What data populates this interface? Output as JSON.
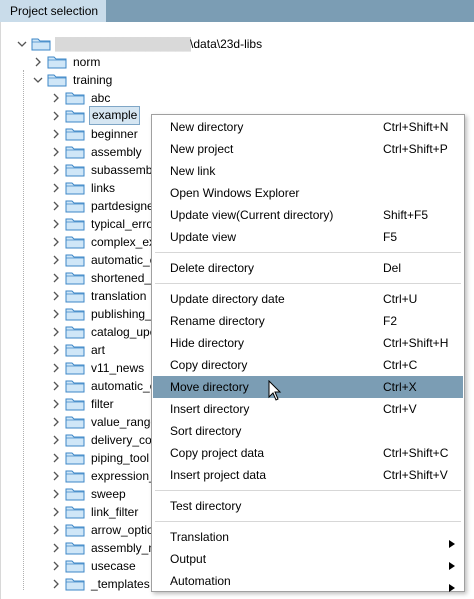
{
  "header": {
    "tab_label": "Project selection"
  },
  "tree": {
    "root": {
      "path_mask": "██████████████████",
      "path_suffix": "\\data\\23d-libs",
      "expanded": true
    },
    "level1": [
      {
        "label": "norm",
        "expanded": false
      },
      {
        "label": "training",
        "expanded": true
      }
    ],
    "children": [
      {
        "label": "abc"
      },
      {
        "label": "example",
        "selected": true
      },
      {
        "label": "beginner"
      },
      {
        "label": "assembly"
      },
      {
        "label": "subassembl"
      },
      {
        "label": "links"
      },
      {
        "label": "partdesigne"
      },
      {
        "label": "typical_erro"
      },
      {
        "label": "complex_ex"
      },
      {
        "label": "automatic_c"
      },
      {
        "label": "shortened_v"
      },
      {
        "label": "translation"
      },
      {
        "label": "publishing_"
      },
      {
        "label": "catalog_upc"
      },
      {
        "label": "art"
      },
      {
        "label": "v11_news"
      },
      {
        "label": "automatic_c"
      },
      {
        "label": "filter"
      },
      {
        "label": "value_range"
      },
      {
        "label": "delivery_co"
      },
      {
        "label": "piping_tool"
      },
      {
        "label": "expression_"
      },
      {
        "label": "sweep"
      },
      {
        "label": "link_filter"
      },
      {
        "label": "arrow_optio"
      },
      {
        "label": "assembly_m"
      },
      {
        "label": "usecase"
      },
      {
        "label": "_templates"
      }
    ]
  },
  "context_menu": {
    "items": [
      {
        "label": "New directory",
        "shortcut": "Ctrl+Shift+N"
      },
      {
        "label": "New project",
        "shortcut": "Ctrl+Shift+P"
      },
      {
        "label": "New link",
        "shortcut": ""
      },
      {
        "label": "Open Windows Explorer",
        "shortcut": ""
      },
      {
        "label": "Update view(Current directory)",
        "shortcut": "Shift+F5"
      },
      {
        "label": "Update view",
        "shortcut": "F5"
      },
      {
        "label": "Delete directory",
        "shortcut": "Del"
      },
      {
        "label": "Update directory date",
        "shortcut": "Ctrl+U"
      },
      {
        "label": "Rename directory",
        "shortcut": "F2"
      },
      {
        "label": "Hide directory",
        "shortcut": "Ctrl+Shift+H"
      },
      {
        "label": "Copy directory",
        "shortcut": "Ctrl+C"
      },
      {
        "label": "Move directory",
        "shortcut": "Ctrl+X",
        "hovered": true
      },
      {
        "label": "Insert directory",
        "shortcut": "Ctrl+V"
      },
      {
        "label": "Sort directory",
        "shortcut": ""
      },
      {
        "label": "Copy project data",
        "shortcut": "Ctrl+Shift+C"
      },
      {
        "label": "Insert project data",
        "shortcut": "Ctrl+Shift+V"
      },
      {
        "label": "Test directory",
        "shortcut": ""
      },
      {
        "label": "Translation",
        "submenu": true
      },
      {
        "label": "Output",
        "submenu": true
      },
      {
        "label": "Automation",
        "submenu": true
      }
    ]
  },
  "colors": {
    "title_bar": "#7b9db4",
    "tab_bg": "#c9dcea",
    "menu_hover": "#7b9db4",
    "folder_fill": "#cfe6f7",
    "folder_stroke": "#3d87c7"
  },
  "icons": {
    "folder": "folder-icon",
    "expander_collapsed": "chevron-right-icon",
    "expander_expanded": "chevron-down-icon",
    "submenu": "submenu-arrow-icon",
    "cursor": "mouse-pointer-icon"
  }
}
